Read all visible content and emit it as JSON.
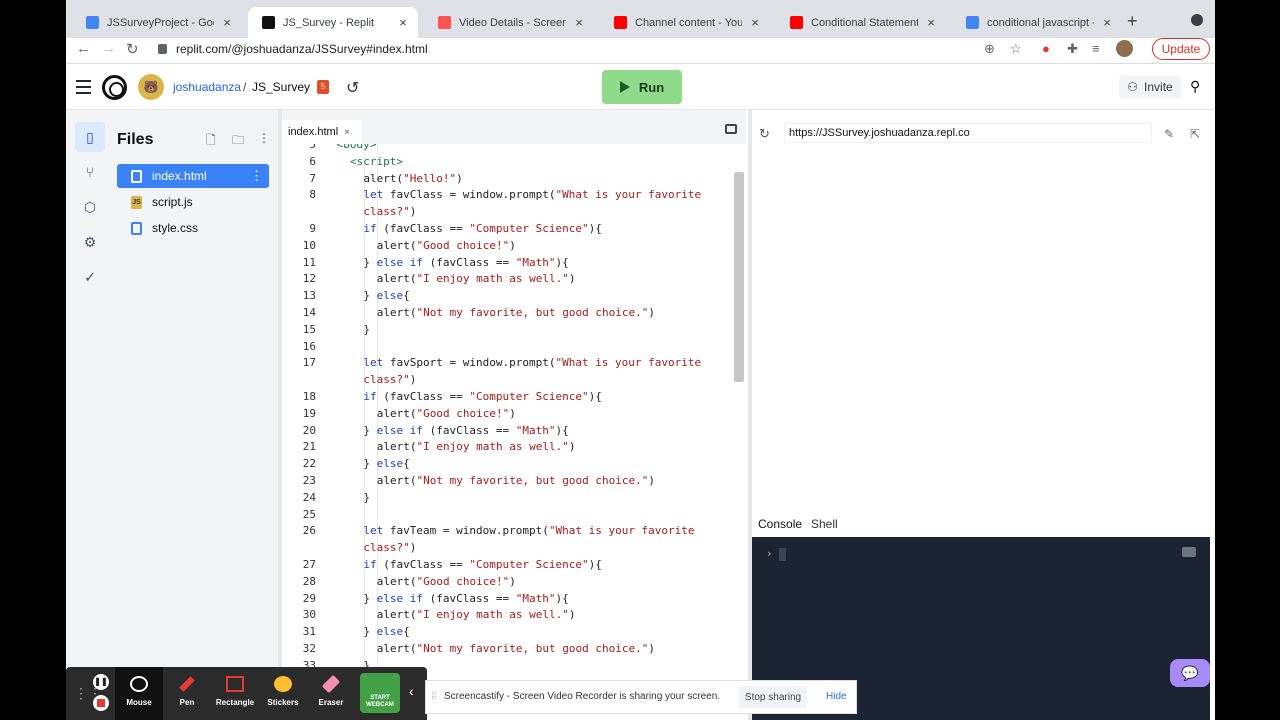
{
  "browser": {
    "tabs": [
      {
        "title": "JSSurveyProject - Google D",
        "icon": "docs-icon",
        "color": "#4285f4"
      },
      {
        "title": "JS_Survey - Replit",
        "icon": "replit-icon",
        "color": "#111111",
        "active": true
      },
      {
        "title": "Video Details - Screencastif",
        "icon": "screencastify-icon",
        "color": "#ff5252"
      },
      {
        "title": "Channel content - YouTube",
        "icon": "youtube-icon",
        "color": "#ff0000"
      },
      {
        "title": "Conditional Statements - If",
        "icon": "youtube-icon",
        "color": "#ff0000"
      },
      {
        "title": "conditional javascript - Goo",
        "icon": "google-icon",
        "color": "#4285f4"
      }
    ],
    "url": "replit.com/@joshuadanza/JSSurvey#index.html",
    "update_label": "Update"
  },
  "replit": {
    "username": "joshuadanza",
    "separator": "/",
    "project": "JS_Survey",
    "run_label": "Run",
    "invite_label": "Invite"
  },
  "files": {
    "title": "Files",
    "items": [
      {
        "name": "index.html",
        "type": "html",
        "active": true
      },
      {
        "name": "script.js",
        "type": "js"
      },
      {
        "name": "style.css",
        "type": "css"
      }
    ]
  },
  "editor": {
    "tab": "index.html",
    "lines": [
      {
        "n": "5",
        "i": 0,
        "html": "<span class=\"tag\">&lt;body&gt;</span>"
      },
      {
        "n": "6",
        "i": 1,
        "html": "<span class=\"tag\">&lt;script&gt;</span>"
      },
      {
        "n": "7",
        "i": 2,
        "html": "alert(<span class=\"str\">\"Hello!\"</span>)"
      },
      {
        "n": "8",
        "i": 2,
        "html": "<span class=\"kw\">let</span> favClass = window.prompt(<span class=\"str\">\"What is your favorite</span>"
      },
      {
        "n": "",
        "i": 2,
        "html": "<span class=\"str\">class?\"</span>)"
      },
      {
        "n": "9",
        "i": 2,
        "html": "<span class=\"kw\">if</span> (favClass == <span class=\"str\">\"Computer Science\"</span>){"
      },
      {
        "n": "10",
        "i": 3,
        "html": "alert(<span class=\"str\">\"Good choice!\"</span>)"
      },
      {
        "n": "11",
        "i": 2,
        "html": "} <span class=\"kw\">else if</span> (favClass == <span class=\"str\">\"Math\"</span>){"
      },
      {
        "n": "12",
        "i": 3,
        "html": "alert(<span class=\"str\">\"I enjoy math as well.\"</span>)"
      },
      {
        "n": "13",
        "i": 2,
        "html": "} <span class=\"kw\">else</span>{"
      },
      {
        "n": "14",
        "i": 3,
        "html": "alert(<span class=\"str\">\"Not my favorite, but good choice.\"</span>)"
      },
      {
        "n": "15",
        "i": 2,
        "html": "}"
      },
      {
        "n": "16",
        "i": 2,
        "html": ""
      },
      {
        "n": "17",
        "i": 2,
        "html": "<span class=\"kw\">let</span> favSport = window.prompt(<span class=\"str\">\"What is your favorite</span>"
      },
      {
        "n": "",
        "i": 2,
        "html": "<span class=\"str\">class?\"</span>)"
      },
      {
        "n": "18",
        "i": 2,
        "html": "<span class=\"kw\">if</span> (favClass == <span class=\"str\">\"Computer Science\"</span>){"
      },
      {
        "n": "19",
        "i": 3,
        "html": "alert(<span class=\"str\">\"Good choice!\"</span>)"
      },
      {
        "n": "20",
        "i": 2,
        "html": "} <span class=\"kw\">else if</span> (favClass == <span class=\"str\">\"Math\"</span>){"
      },
      {
        "n": "21",
        "i": 3,
        "html": "alert(<span class=\"str\">\"I enjoy math as well.\"</span>)"
      },
      {
        "n": "22",
        "i": 2,
        "html": "} <span class=\"kw\">else</span>{"
      },
      {
        "n": "23",
        "i": 3,
        "html": "alert(<span class=\"str\">\"Not my favorite, but good choice.\"</span>)"
      },
      {
        "n": "24",
        "i": 2,
        "html": "}"
      },
      {
        "n": "25",
        "i": 2,
        "html": ""
      },
      {
        "n": "26",
        "i": 2,
        "html": "<span class=\"kw\">let</span> favTeam = window.prompt(<span class=\"str\">\"What is your favorite</span>"
      },
      {
        "n": "",
        "i": 2,
        "html": "<span class=\"str\">class?\"</span>)"
      },
      {
        "n": "27",
        "i": 2,
        "html": "<span class=\"kw\">if</span> (favClass == <span class=\"str\">\"Computer Science\"</span>){"
      },
      {
        "n": "28",
        "i": 3,
        "html": "alert(<span class=\"str\">\"Good choice!\"</span>)"
      },
      {
        "n": "29",
        "i": 2,
        "html": "} <span class=\"kw\">else if</span> (favClass == <span class=\"str\">\"Math\"</span>){"
      },
      {
        "n": "30",
        "i": 3,
        "html": "alert(<span class=\"str\">\"I enjoy math as well.\"</span>)"
      },
      {
        "n": "31",
        "i": 2,
        "html": "} <span class=\"kw\">else</span>{"
      },
      {
        "n": "32",
        "i": 3,
        "html": "alert(<span class=\"str\">\"Not my favorite, but good choice.\"</span>)"
      },
      {
        "n": "33",
        "i": 2,
        "html": "}"
      }
    ]
  },
  "webview": {
    "url": "https://JSSurvey.joshuadanza.repl.co"
  },
  "console": {
    "tabs": [
      "Console",
      "Shell"
    ],
    "prompt": "›"
  },
  "screencastify": {
    "tools": [
      {
        "label": "Mouse",
        "active": true,
        "color": "#ffffff"
      },
      {
        "label": "Pen",
        "color": "#e53935"
      },
      {
        "label": "Rectangle",
        "color": "#e53935"
      },
      {
        "label": "Stickers",
        "color": "#fbc02d"
      },
      {
        "label": "Eraser",
        "color": "#f48fb1"
      }
    ],
    "webcam_label": "START WEBCAM",
    "sharing_text": "Screencastify - Screen Video Recorder is sharing your screen.",
    "stop_sharing_label": "Stop sharing",
    "hide_label": "Hide"
  }
}
